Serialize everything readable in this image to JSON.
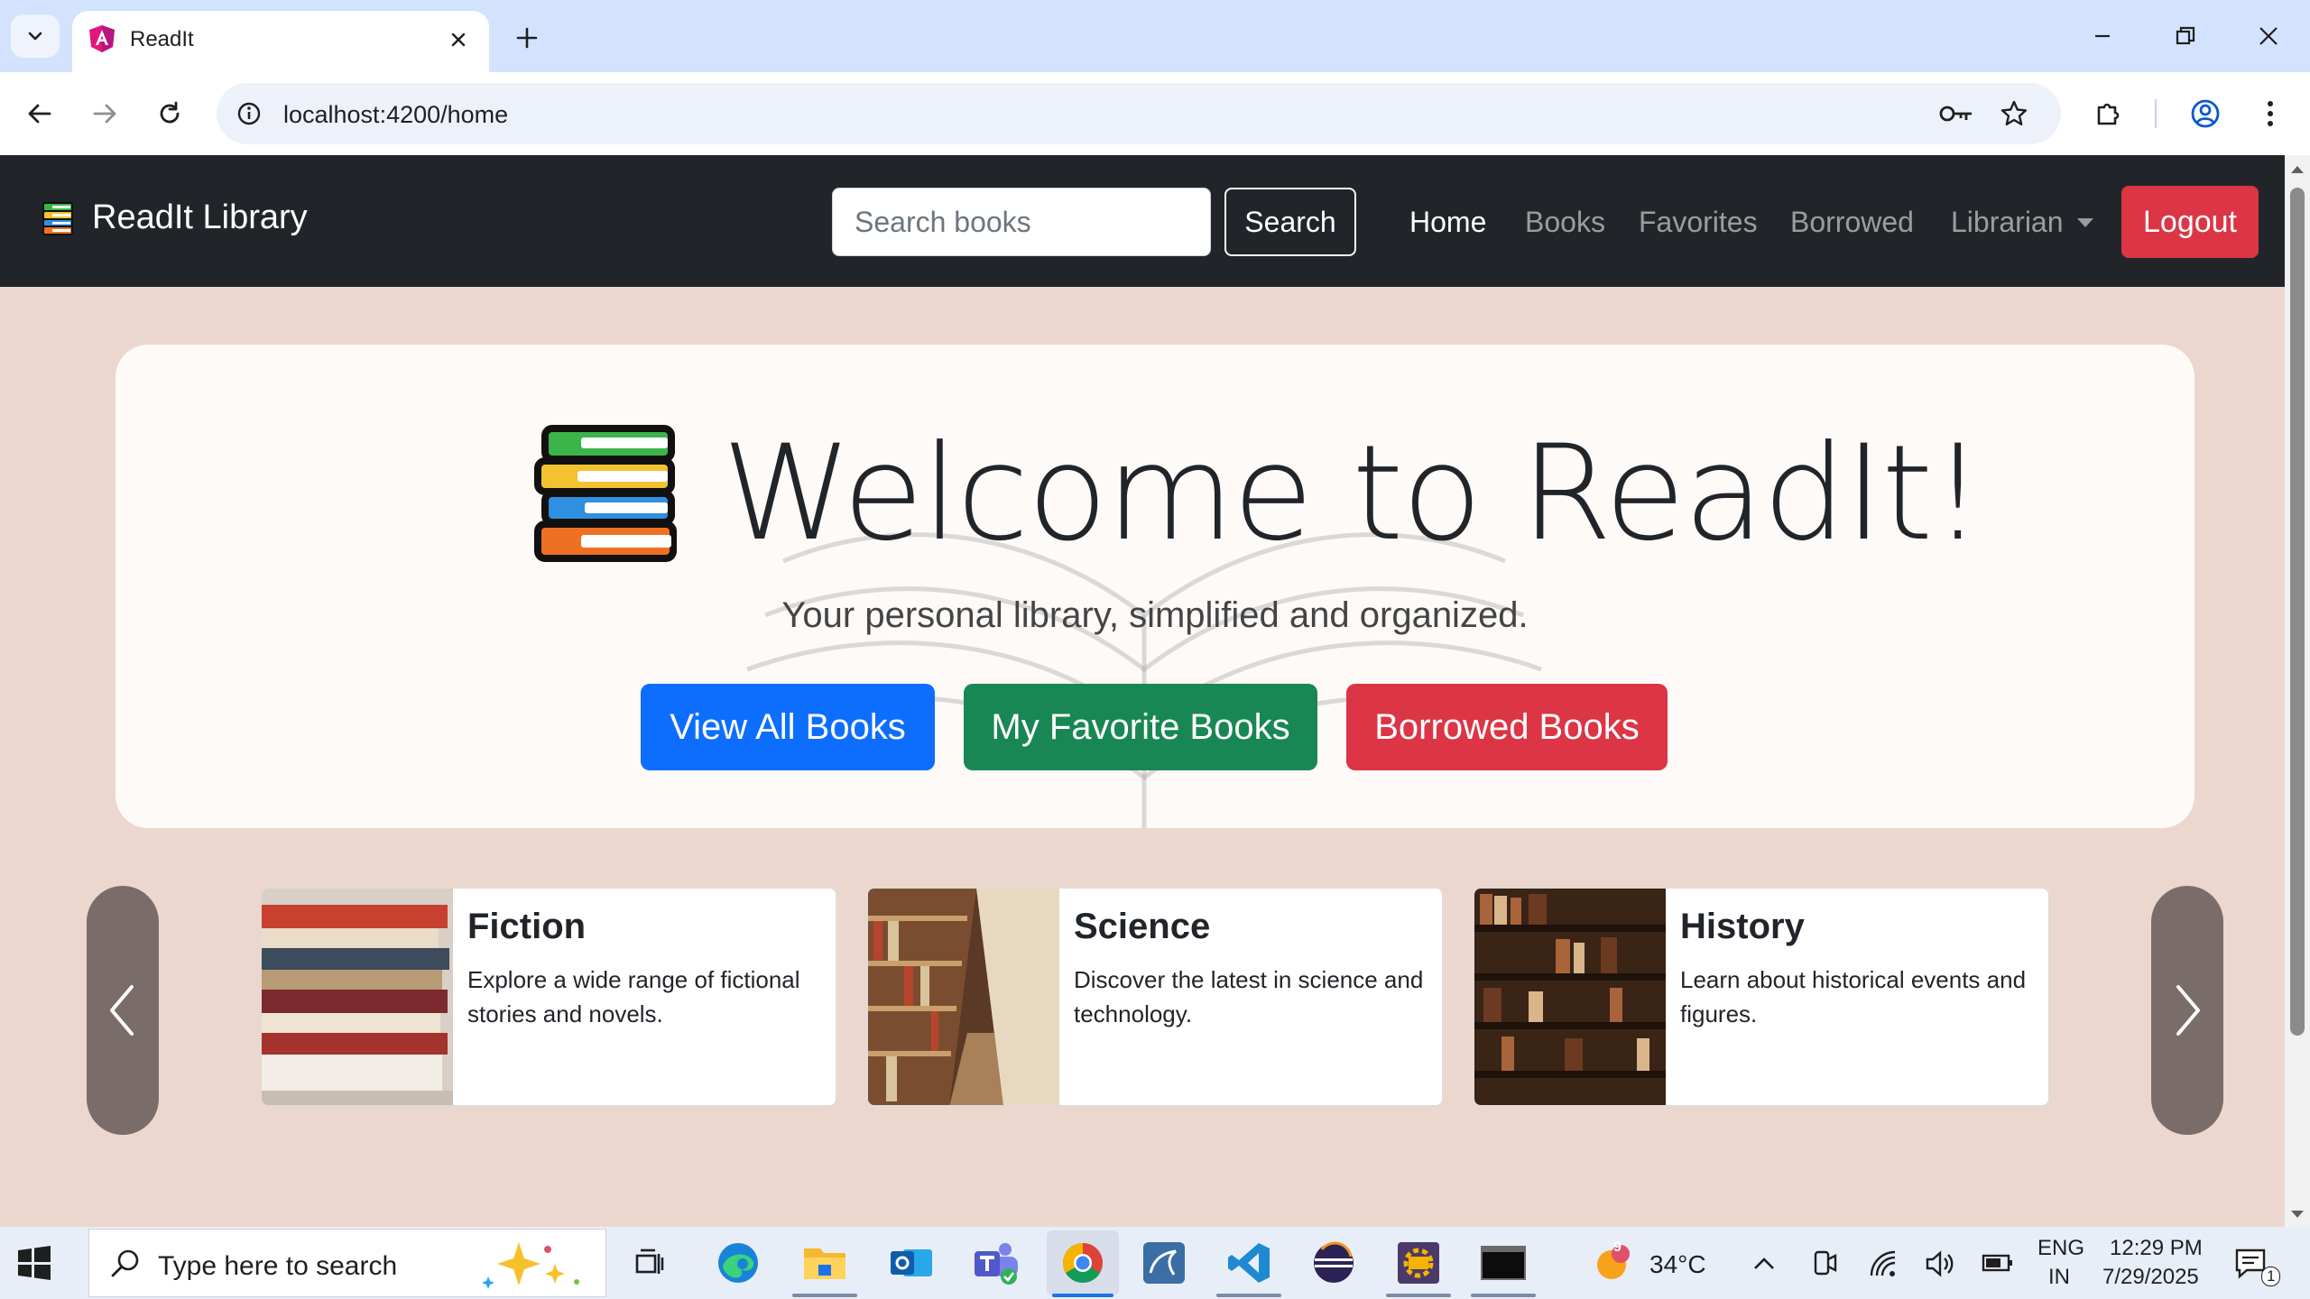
{
  "browser": {
    "tab_title": "ReadIt",
    "url": "localhost:4200/home"
  },
  "navbar": {
    "brand": "ReadIt Library",
    "search_placeholder": "Search books",
    "search_button": "Search",
    "links": [
      "Home",
      "Books",
      "Favorites",
      "Borrowed",
      "Librarian"
    ],
    "active_link": "Home",
    "logout": "Logout"
  },
  "hero": {
    "title": "Welcome to ReadIt!",
    "subtitle": "Your personal library, simplified and organized.",
    "buttons": {
      "view_all": "View All Books",
      "favorites": "My Favorite Books",
      "borrowed": "Borrowed Books"
    }
  },
  "categories": [
    {
      "title": "Fiction",
      "description": "Explore a wide range of fictional stories and novels."
    },
    {
      "title": "Science",
      "description": "Discover the latest in science and technology."
    },
    {
      "title": "History",
      "description": "Learn about historical events and figures."
    }
  ],
  "taskbar": {
    "search_placeholder": "Type here to search",
    "weather": "34°C",
    "weather_badge": "9",
    "language": "ENG",
    "region": "IN",
    "time": "12:29 PM",
    "date": "7/29/2025",
    "notifications": "1"
  },
  "colors": {
    "page_bg": "#ecd7cf",
    "navbar_bg": "#212529",
    "primary": "#0d6efd",
    "success": "#198754",
    "danger": "#dc3545"
  }
}
